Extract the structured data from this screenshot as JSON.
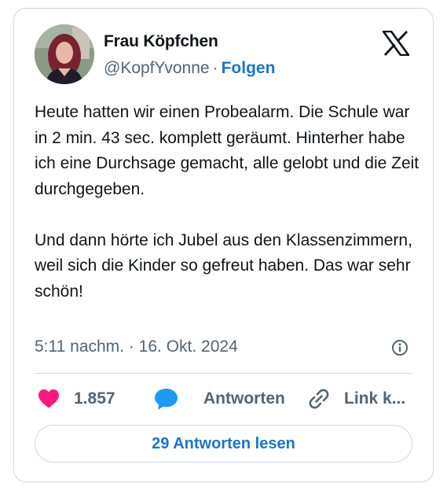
{
  "author": {
    "name": "Frau Köpfchen",
    "handle": "@KopfYvonne",
    "separator": "·",
    "follow_label": "Folgen"
  },
  "post": {
    "paragraphs": [
      "Heute hatten wir einen Probealarm. Die Schule war in 2 min. 43 sec. komplett geräumt. Hinterher habe ich eine Durchsage gemacht, alle gelobt und die Zeit durchgegeben.",
      "Und dann hörte ich Jubel aus den Klassenzimmern, weil sich die Kinder so gefreut haben. Das war sehr schön!"
    ],
    "timestamp": "5:11 nachm. · 16. Okt. 2024"
  },
  "actions": {
    "likes_count": "1.857",
    "reply_label": "Antworten",
    "link_label": "Link k..."
  },
  "read_replies_label": "29 Antworten lesen",
  "colors": {
    "accent": "#1d74c9",
    "like": "#f91880",
    "reply_icon": "#1d9bf0",
    "muted": "#536471",
    "border": "#cfd9de"
  },
  "icons": [
    "x-logo-icon",
    "heart-icon",
    "speech-bubble-icon",
    "link-icon",
    "info-icon"
  ]
}
